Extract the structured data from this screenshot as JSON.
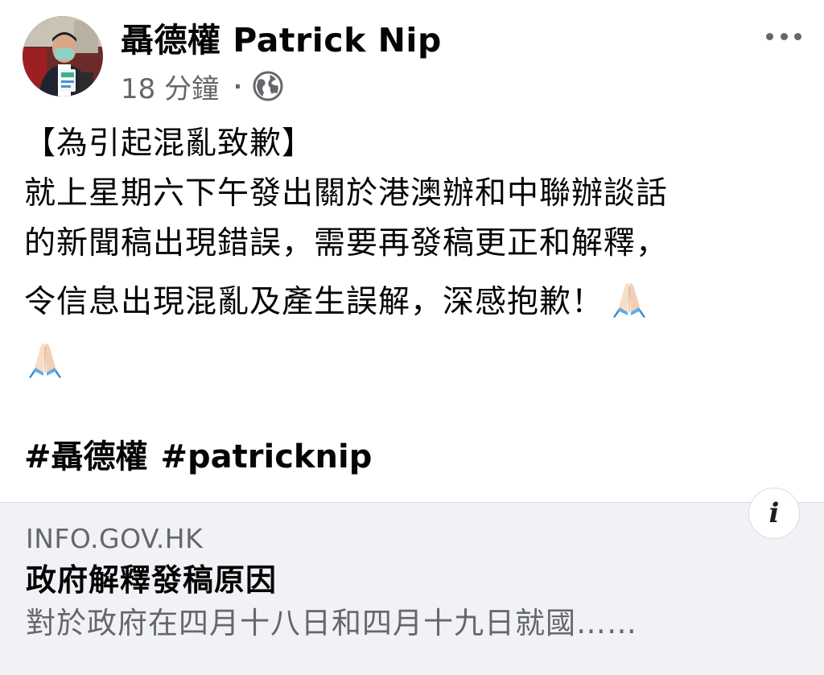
{
  "author": {
    "name": "聶德權 Patrick Nip",
    "time": "18 分鐘",
    "separator": "·",
    "privacy_icon": "globe-icon"
  },
  "post": {
    "heading": "【為引起混亂致歉】",
    "line1": "就上星期六下午發出關於港澳辦和中聯辦談話",
    "line2": "的新聞稿出現錯誤，需要再發稿更正和解釋，",
    "line3": "令信息出現混亂及產生誤解，深感抱歉！",
    "emoji_icon": "folded-hands-icon"
  },
  "hashtags": [
    "#聶德權",
    "#patricknip"
  ],
  "link_preview": {
    "domain": "INFO.GOV.HK",
    "title": "政府解釋發稿原因",
    "description": "對於政府在四月十八日和四月十九日就國……",
    "info_label": "i"
  },
  "colors": {
    "text": "#050505",
    "secondary": "#65676b",
    "card_bg": "#f0f2f5"
  }
}
